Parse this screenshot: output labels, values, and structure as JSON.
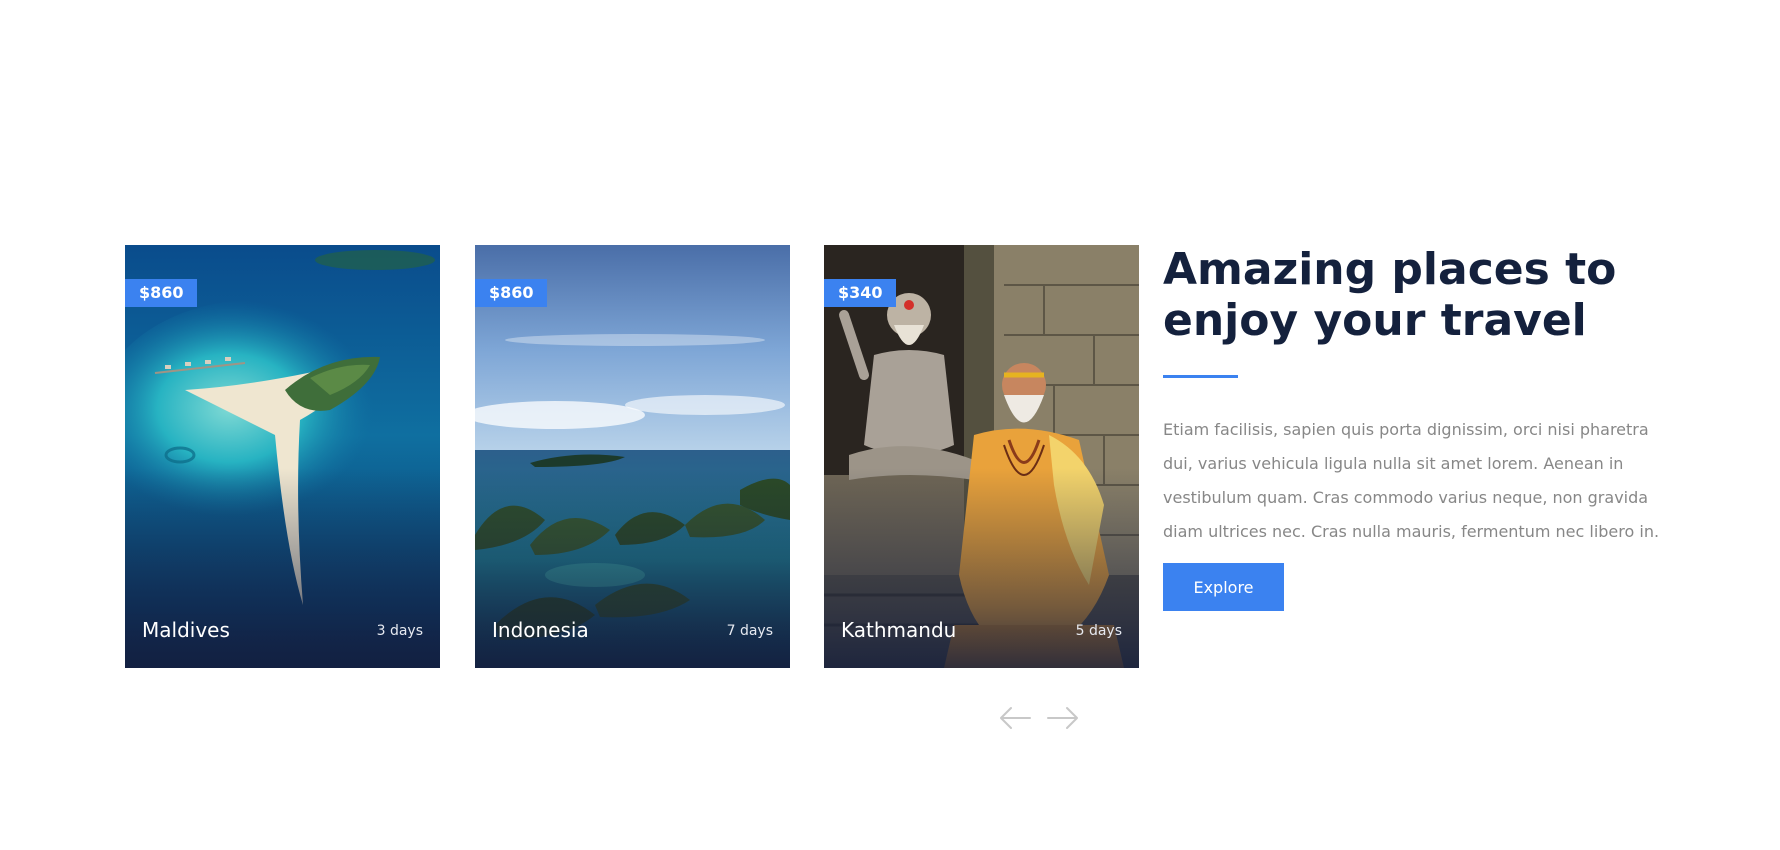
{
  "cards": [
    {
      "price": "$860",
      "name": "Maldives",
      "duration": "3 days",
      "image": "aerial-island-photo"
    },
    {
      "price": "$860",
      "name": "Indonesia",
      "duration": "7 days",
      "image": "tropical-islands-photo"
    },
    {
      "price": "$340",
      "name": "Kathmandu",
      "duration": "5 days",
      "image": "sadhu-portrait-photo"
    }
  ],
  "heading": "Amazing places to enjoy your travel",
  "description": "Etiam facilisis, sapien quis porta dignissim, orci nisi pharetra dui, varius vehicula ligula nulla sit amet lorem. Aenean in vestibulum quam. Cras commodo varius neque, non gravida diam ultrices nec. Cras nulla mauris, fermentum nec libero in.",
  "explore_label": "Explore",
  "nav": {
    "prev_icon": "arrow-left-icon",
    "next_icon": "arrow-right-icon"
  },
  "colors": {
    "accent": "#3b82f0",
    "heading": "#14213d",
    "body_text": "#878787",
    "arrow": "#c8c8c8"
  }
}
